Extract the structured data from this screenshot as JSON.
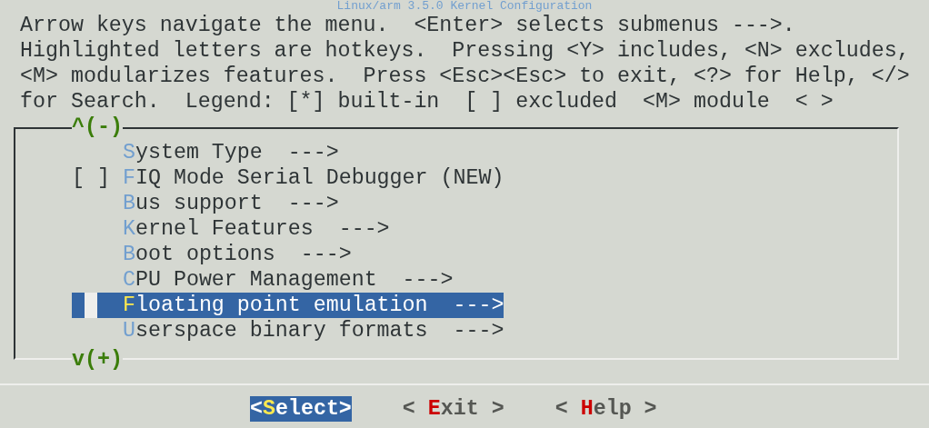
{
  "window": {
    "title": "Linux/arm 3.5.0 Kernel Configuration"
  },
  "help_lines": [
    "Arrow keys navigate the menu.  <Enter> selects submenus --->.",
    "Highlighted letters are hotkeys.  Pressing <Y> includes, <N> excludes,",
    "<M> modularizes features.  Press <Esc><Esc> to exit, <?> for Help, </>",
    "for Search.  Legend: [*] built-in  [ ] excluded  <M> module  < >"
  ],
  "menu": {
    "scroll_up": "^(-)",
    "scroll_down": "v(+)",
    "items": [
      {
        "kind": "submenu",
        "label": "System Type",
        "arrow": "--->",
        "selected": false
      },
      {
        "kind": "bool",
        "checkbox": "[ ]",
        "checked": false,
        "label": "FIQ Mode Serial Debugger (NEW)",
        "selected": false
      },
      {
        "kind": "submenu",
        "label": "Bus support",
        "arrow": "--->",
        "selected": false
      },
      {
        "kind": "submenu",
        "label": "Kernel Features",
        "arrow": "--->",
        "selected": false
      },
      {
        "kind": "submenu",
        "label": "Boot options",
        "arrow": "--->",
        "selected": false
      },
      {
        "kind": "submenu",
        "label": "CPU Power Management",
        "arrow": "--->",
        "selected": false
      },
      {
        "kind": "submenu",
        "label": "Floating point emulation",
        "arrow": "--->",
        "selected": true
      },
      {
        "kind": "submenu",
        "label": "Userspace binary formats",
        "arrow": "--->",
        "selected": false
      }
    ]
  },
  "buttons": [
    {
      "before": "<",
      "hotkey": "S",
      "after": "elect>",
      "selected": true
    },
    {
      "before": "< ",
      "hotkey": "E",
      "after": "xit >",
      "selected": false
    },
    {
      "before": "< ",
      "hotkey": "H",
      "after": "elp >",
      "selected": false
    }
  ]
}
